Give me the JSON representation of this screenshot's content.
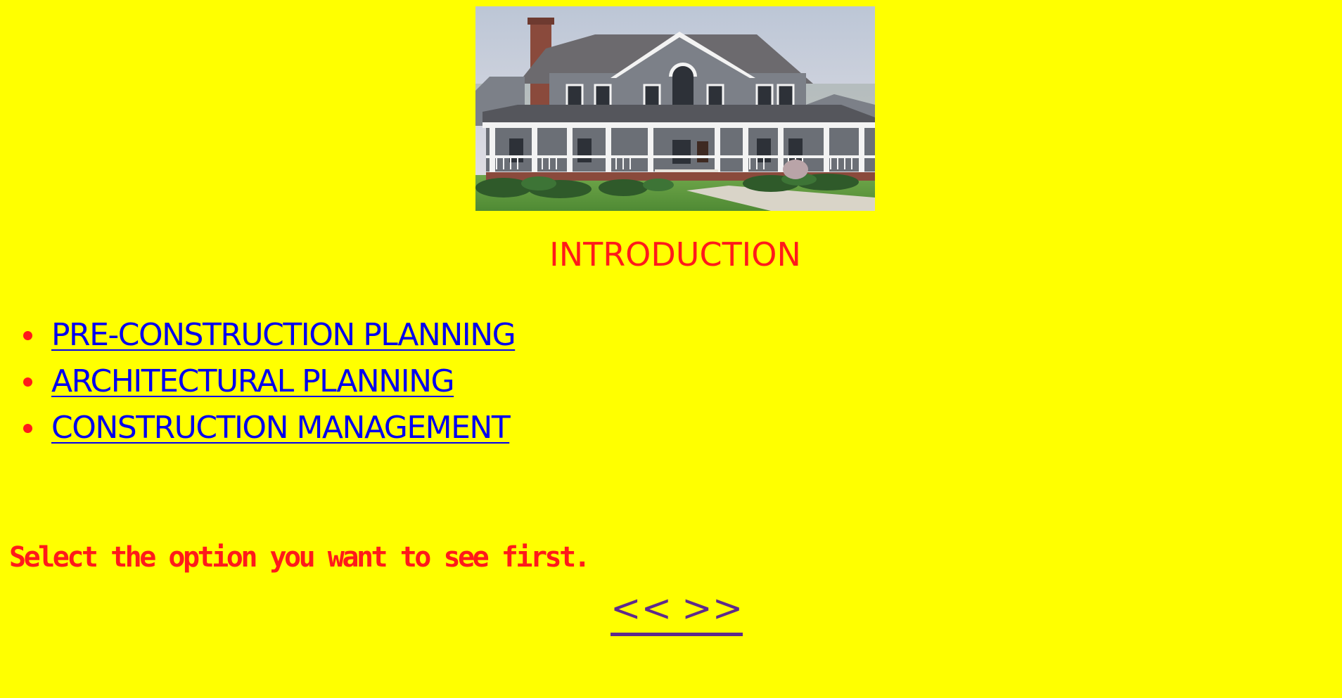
{
  "hero": {
    "image": "house-photo"
  },
  "heading": "INTRODUCTION",
  "options": [
    {
      "label": "PRE-CONSTRUCTION PLANNING"
    },
    {
      "label": "ARCHITECTURAL PLANNING"
    },
    {
      "label": "CONSTRUCTION MANAGEMENT"
    }
  ],
  "instruction": "Select the option you want to see first.",
  "pager": {
    "prev_label": "<<",
    "next_label": ">>"
  },
  "colors": {
    "background": "#ffff00",
    "heading": "#ff1a1a",
    "link": "#0000ee",
    "pager": "#5e2a8c"
  }
}
